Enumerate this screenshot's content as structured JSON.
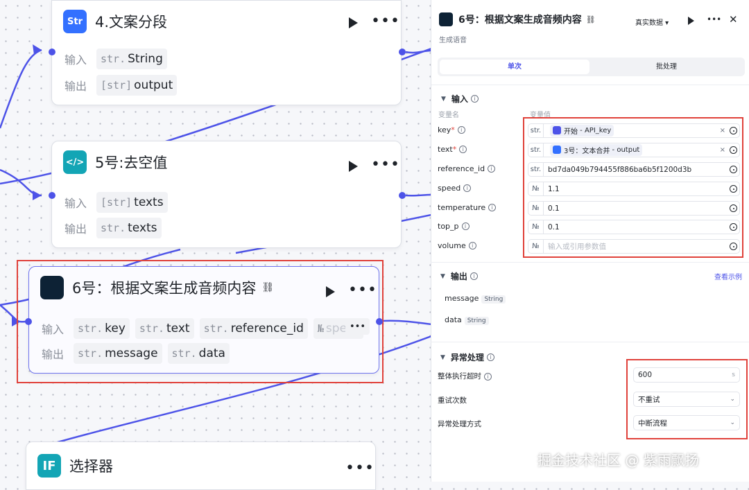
{
  "nodes": {
    "n4": {
      "title": "4.文案分段",
      "icon": "Str",
      "in_label": "输入",
      "out_label": "输出",
      "inputs": [
        {
          "type": "str.",
          "name": "String"
        }
      ],
      "outputs": [
        {
          "type": "[str]",
          "name": "output"
        }
      ]
    },
    "n5": {
      "title": "5号:去空值",
      "icon": "</>",
      "in_label": "输入",
      "out_label": "输出",
      "inputs": [
        {
          "type": "[str]",
          "name": "texts"
        }
      ],
      "outputs": [
        {
          "type": "str.",
          "name": "texts"
        }
      ]
    },
    "n6": {
      "title": "6号：根据文案生成音频内容",
      "in_label": "输入",
      "out_label": "输出",
      "inputs": [
        {
          "type": "str.",
          "name": "key"
        },
        {
          "type": "str.",
          "name": "text"
        },
        {
          "type": "str.",
          "name": "reference_id"
        },
        {
          "type": "№",
          "name": "speed"
        }
      ],
      "outputs": [
        {
          "type": "str.",
          "name": "message"
        },
        {
          "type": "str.",
          "name": "data"
        }
      ]
    },
    "sel": {
      "title": "选择器",
      "icon": "IF"
    }
  },
  "panel": {
    "title": "6号：根据文案生成音频内容",
    "subtitle": "生成语音",
    "data_mode": "真实数据",
    "tabs": [
      "单次",
      "批处理"
    ],
    "input_section": "输入",
    "col_name": "变量名",
    "col_value": "变量值",
    "inputs": [
      {
        "name": "key",
        "required": true,
        "type": "str.",
        "chip": true,
        "node": "开始",
        "value": "API_key"
      },
      {
        "name": "text",
        "required": true,
        "type": "str.",
        "chip": true,
        "node": "3号：文本合并",
        "value": "output"
      },
      {
        "name": "reference_id",
        "required": false,
        "type": "str.",
        "chip": false,
        "value": "bd7da049b794455f886ba6b5f1200d3b"
      },
      {
        "name": "speed",
        "required": false,
        "type": "№",
        "chip": false,
        "value": "1.1"
      },
      {
        "name": "temperature",
        "required": false,
        "type": "№",
        "chip": false,
        "value": "0.1"
      },
      {
        "name": "top_p",
        "required": false,
        "type": "№",
        "chip": false,
        "value": "0.1"
      },
      {
        "name": "volume",
        "required": false,
        "type": "№",
        "chip": false,
        "placeholder": "输入或引用参数值"
      }
    ],
    "output_section": "输出",
    "see_example": "查看示例",
    "outputs": [
      {
        "name": "message",
        "type": "String"
      },
      {
        "name": "data",
        "type": "String"
      }
    ],
    "error_section": "异常处理",
    "timeout_label": "整体执行超时",
    "timeout_value": "600",
    "timeout_unit": "s",
    "retry_label": "重试次数",
    "retry_value": "不重试",
    "mode_label": "异常处理方式",
    "mode_value": "中断流程"
  },
  "watermark": "掘金技术社区 @ 紫雨飘扬",
  "colors": {
    "accent": "#4d53e8",
    "highlight": "#e0413a"
  }
}
